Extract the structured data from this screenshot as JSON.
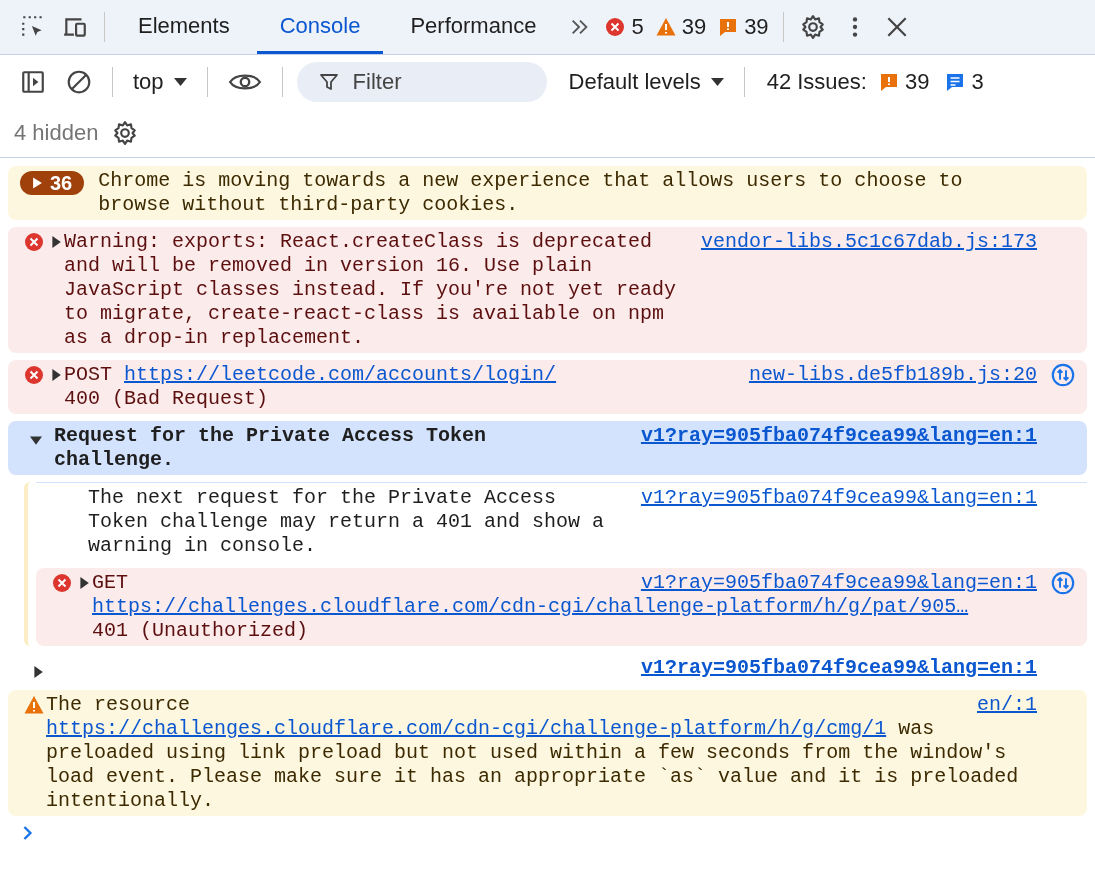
{
  "tabs": [
    {
      "label": "Elements",
      "selected": false
    },
    {
      "label": "Console",
      "selected": true
    },
    {
      "label": "Performance",
      "selected": false
    }
  ],
  "counters": {
    "errors": "5",
    "warnings": "39",
    "issues": "39"
  },
  "toolbar": {
    "context": "top",
    "filter_placeholder": "Filter",
    "levels": "Default levels",
    "issues_label": "42 Issues:",
    "issue_count": "39",
    "info_count": "3",
    "hidden": "4 hidden"
  },
  "messages": [
    {
      "kind": "issue",
      "count": "36",
      "segments": [
        {
          "text": "Chrome is moving towards a new experience that allows users to choose to browse without third-party cookies."
        }
      ]
    },
    {
      "kind": "error",
      "expanded": false,
      "source": "vendor-libs.5c1c67dab.js:173",
      "network": false,
      "segments": [
        {
          "text": "Warning: exports: React.createClass is deprecated and will be removed in version 16. Use plain JavaScript classes instead. If you're not yet ready to migrate, create-react-class is available on npm as a drop-in replacement."
        }
      ]
    },
    {
      "kind": "error",
      "expanded": false,
      "source": "new-libs.de5fb189b.js:20",
      "network": true,
      "segments": [
        {
          "text": "POST "
        },
        {
          "url": "https://leetcode.com/accounts/login/"
        }
      ],
      "more": [
        {
          "text": "400 (Bad Request)"
        }
      ]
    },
    {
      "kind": "group",
      "expanded": true,
      "source": "v1?ray=905fba074f9cea99&lang=en:1",
      "segments": [
        {
          "text": "Request for the Private Access Token challenge."
        }
      ],
      "children": [
        {
          "kind": "info",
          "source": "v1?ray=905fba074f9cea99&lang=en:1",
          "segments": [
            {
              "text": "The next request for the Private Access Token challenge may return a 401 and show a warning in console."
            }
          ]
        },
        {
          "kind": "error",
          "expanded": false,
          "source": "v1?ray=905fba074f9cea99&lang=en:1",
          "network": true,
          "segments": [
            {
              "text": "GET"
            }
          ],
          "more": [
            {
              "url": "https://challenges.cloudflare.com/cdn-cgi/challenge-platform/h/g/pat/905…"
            },
            {
              "text": "\n401 (Unauthorized)"
            }
          ]
        }
      ]
    },
    {
      "kind": "log",
      "expanded": false,
      "source": "v1?ray=905fba074f9cea99&lang=en:1"
    },
    {
      "kind": "warning",
      "source": "en/:1",
      "segments": [
        {
          "text": "The resource"
        }
      ],
      "more": [
        {
          "url": "https://challenges.cloudflare.com/cdn-cgi/challenge-platform/h/g/cmg/1"
        },
        {
          "text": " was preloaded using link preload but not used within a few seconds from the window's load event. Please make sure it has an appropriate `as` value and it is preloaded intentionally."
        }
      ]
    }
  ]
}
